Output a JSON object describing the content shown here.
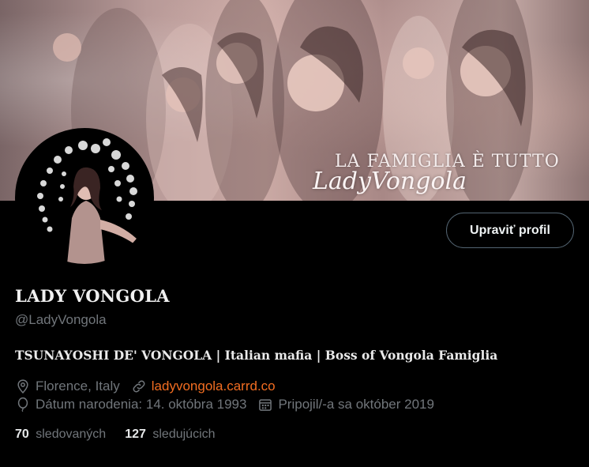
{
  "banner": {
    "tagline": "LA FAMIGLIA È TUTTO",
    "signature": "LadyVongola"
  },
  "profile": {
    "edit_button": "Upraviť profil",
    "display_name": "LADY VONGOLA",
    "handle": "@LadyVongola",
    "bio": "TSUNAYOSHI DE' VONGOLA | Italian mafia | Boss of Vongola Famiglia",
    "location": "Florence, Italy",
    "website": "ladyvongola.carrd.co",
    "birthday": "Dátum narodenia: 14. októbra 1993",
    "joined": "Pripojil/-a sa október 2019"
  },
  "stats": {
    "following_count": "70",
    "following_label": "sledovaných",
    "followers_count": "127",
    "followers_label": "sledujúcich"
  },
  "icons": {
    "location": "location-pin-icon",
    "link": "link-icon",
    "birthday": "balloon-icon",
    "joined": "calendar-icon"
  },
  "colors": {
    "link": "#f26d21",
    "muted": "#71767b",
    "background": "#000000"
  }
}
